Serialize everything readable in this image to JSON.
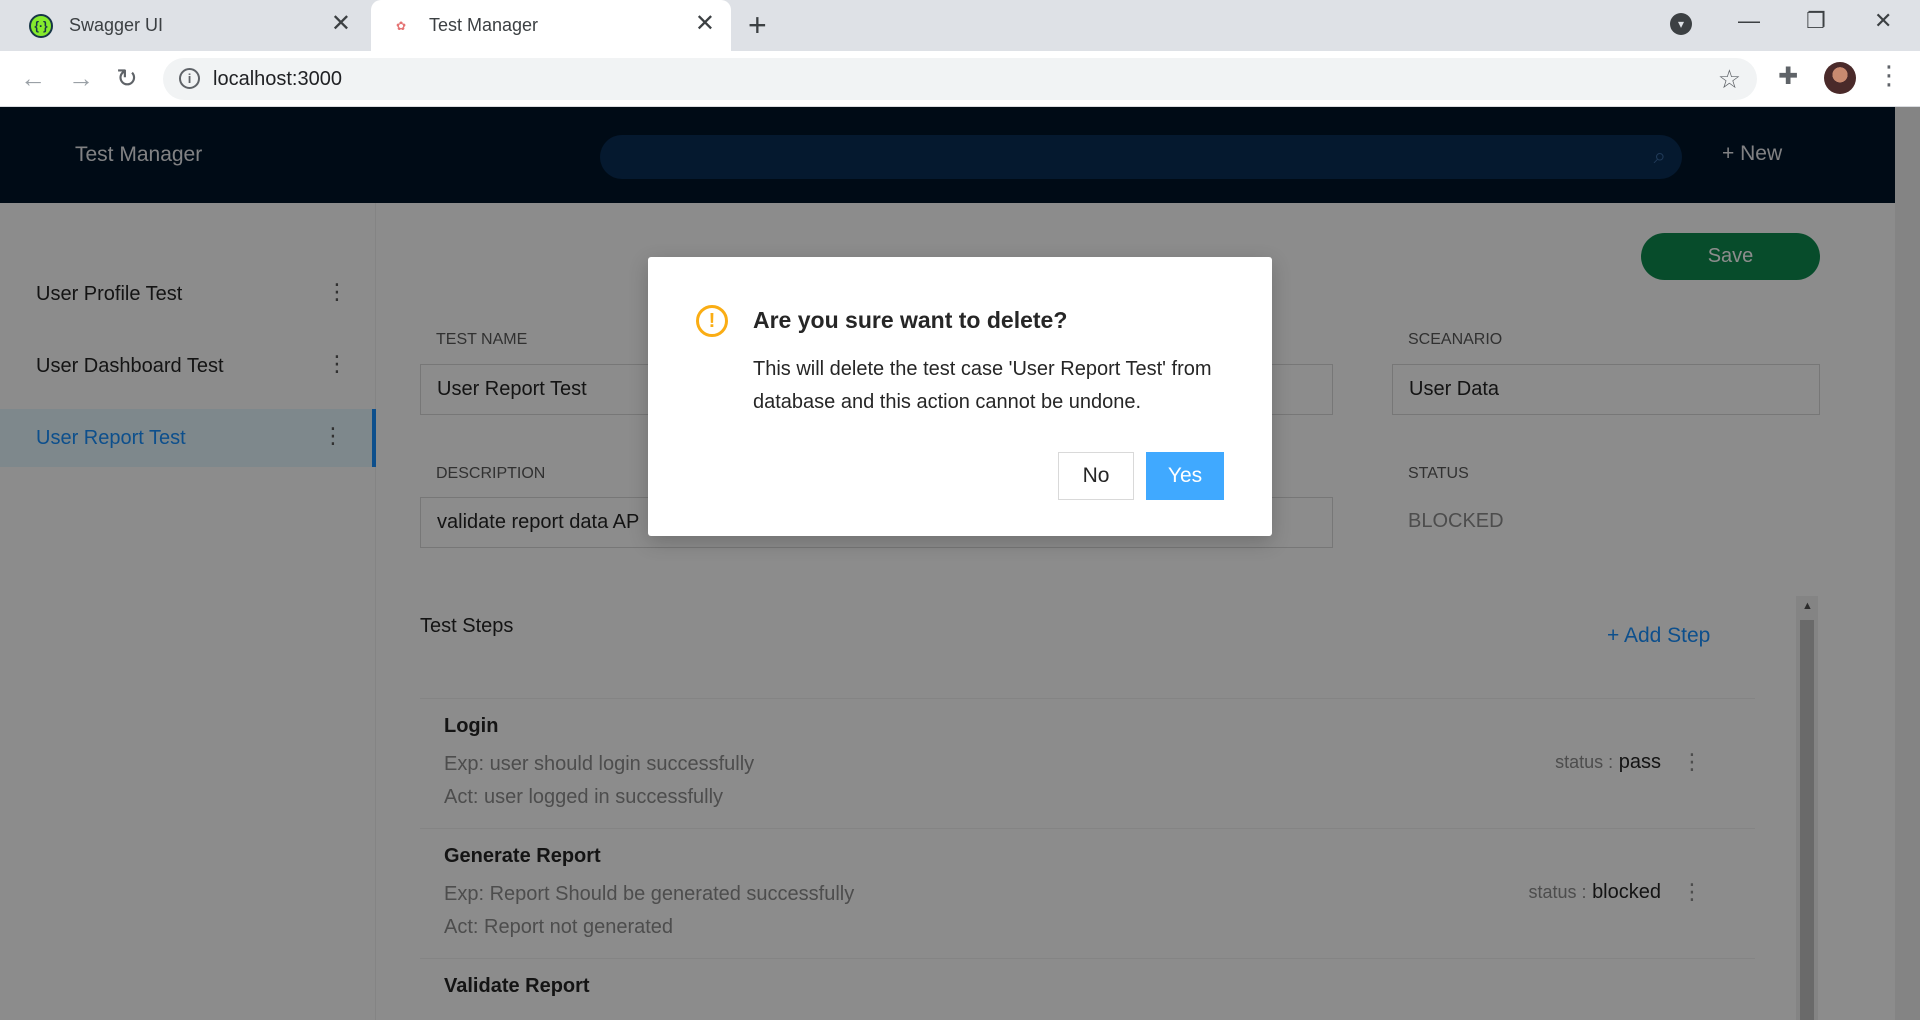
{
  "browser": {
    "tabs": [
      {
        "label": "Swagger UI",
        "icon": "swagger-icon"
      },
      {
        "label": "Test Manager",
        "icon": "octopus-icon"
      }
    ],
    "address": "localhost:3000"
  },
  "app": {
    "title": "Test Manager",
    "new_label": "New",
    "accent_color": "#1890ff",
    "header_color": "#001529"
  },
  "sidebar": {
    "items": [
      {
        "label": "User Profile Test"
      },
      {
        "label": "User Dashboard Test"
      },
      {
        "label": "User Report Test",
        "active": true
      }
    ]
  },
  "form": {
    "save_label": "Save",
    "test_name_label": "TEST NAME",
    "test_name_value": "User Report Test",
    "scenario_label": "SCEANARIO",
    "scenario_value": "User Data",
    "description_label": "DESCRIPTION",
    "description_value": "validate report data AP",
    "status_label": "STATUS",
    "status_value": "BLOCKED"
  },
  "steps": {
    "title": "Test Steps",
    "add_label": "Add Step",
    "items": [
      {
        "name": "Login",
        "exp": "Exp: user should login successfully",
        "act": "Act: user logged in successfully",
        "status_key": "status :",
        "status_value": "pass"
      },
      {
        "name": "Generate Report",
        "exp": "Exp: Report Should be generated successfully",
        "act": "Act: Report not generated",
        "status_key": "status :",
        "status_value": "blocked"
      },
      {
        "name": "Validate Report",
        "exp": "",
        "act": "",
        "status_key": "",
        "status_value": ""
      }
    ]
  },
  "modal": {
    "title": "Are you sure want to delete?",
    "body": "This will delete the test case 'User Report Test' from database and this action cannot be undone.",
    "no_label": "No",
    "yes_label": "Yes",
    "warning_color": "#faad14"
  }
}
